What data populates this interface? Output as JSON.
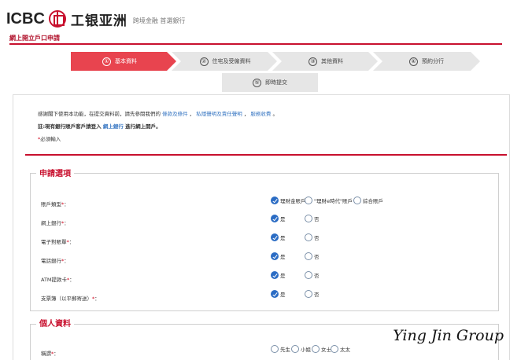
{
  "top_links": "",
  "header": {
    "logo_en": "ICBC",
    "logo_cn": "工银亚洲",
    "slogan": "跨境金融 首選銀行"
  },
  "page_title": "網上開立戶口申請",
  "steps": [
    {
      "num": "①",
      "label": "基本資料",
      "active": true
    },
    {
      "num": "②",
      "label": "住宅及受僱資料",
      "active": false
    },
    {
      "num": "③",
      "label": "其他資料",
      "active": false
    },
    {
      "num": "④",
      "label": "預約分行",
      "active": false
    },
    {
      "num": "⑤",
      "label": "即時提交",
      "active": false
    }
  ],
  "intro": {
    "line1_prefix": "感謝閣下使用本功能，在提交資料前，請先參閱我們的",
    "link_terms": "條款及條件",
    "sep1": "，",
    "link_privacy": "私隱聲明及責任聲明",
    "sep2": "，",
    "link_fees": "服務收費",
    "line1_suffix": "。",
    "line2_prefix": "註:現有銀行賬戶客戶請登入",
    "line2_link": "網上銀行",
    "line2_suffix": "進行網上開戶。",
    "required_mark": "*",
    "required_note": "必須輸入"
  },
  "sections": {
    "application": {
      "title": "申請選項",
      "account_type": {
        "label": "賬戶類型",
        "req": "*",
        "colon": "：",
        "options": [
          "理財金賬戶",
          "\"理財e時代\"賬戶",
          "綜合賬戶"
        ]
      },
      "rows": [
        {
          "label": "網上銀行",
          "req": "*",
          "colon": "：",
          "yes": "是",
          "no": "否"
        },
        {
          "label": "電子對賬單",
          "req": "*",
          "colon": "：",
          "yes": "是",
          "no": "否"
        },
        {
          "label": "電話銀行",
          "req": "*",
          "colon": "：",
          "yes": "是",
          "no": "否"
        },
        {
          "label": "ATM提款卡",
          "req": "*",
          "colon": "：",
          "yes": "是",
          "no": "否"
        },
        {
          "label": "支票簿（以平郵寄送）",
          "req": "*",
          "colon": "：",
          "yes": "是",
          "no": "否"
        }
      ]
    },
    "personal": {
      "title": "個人資料",
      "salutation": {
        "label": "稱謂",
        "req": "*",
        "colon": "：",
        "options": [
          "先生",
          "小姐",
          "女士",
          "太太"
        ]
      }
    }
  },
  "watermark": "Ying Jin Group",
  "colors": {
    "brand_red": "#c8102e",
    "step_active": "#e8444f",
    "step_inactive": "#e6e6e6",
    "link_blue": "#3a78c3",
    "radio_checked": "#2b6cc4"
  }
}
